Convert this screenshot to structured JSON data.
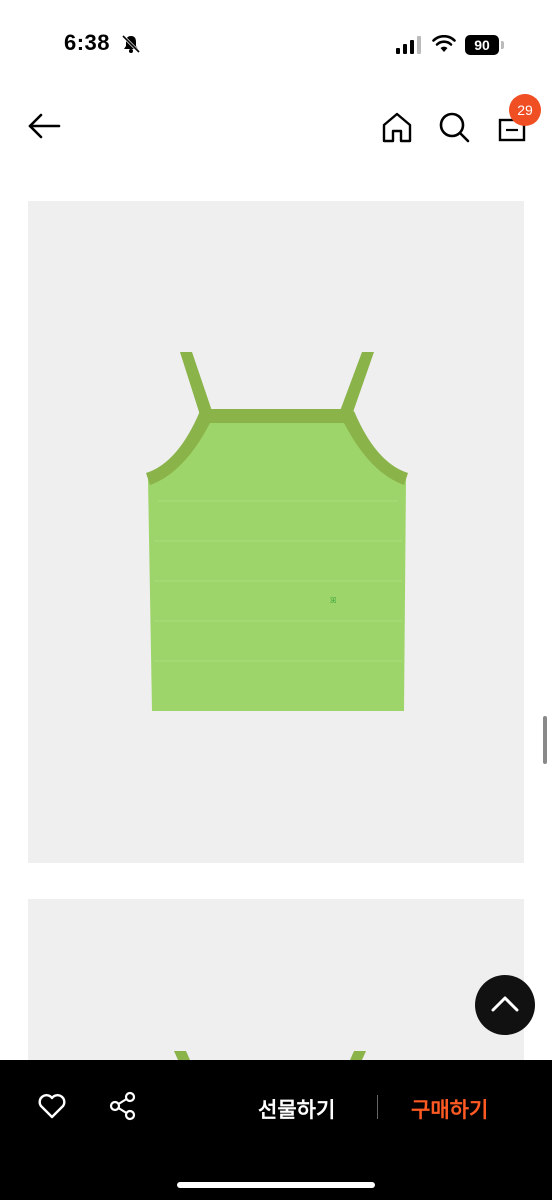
{
  "status_bar": {
    "time": "6:38",
    "battery": "90"
  },
  "header": {
    "cart_count": "29"
  },
  "bottom_bar": {
    "gift_label": "선물하기",
    "buy_label": "구매하기"
  },
  "colors": {
    "accent": "#f04e23",
    "buy_text": "#ff5a23",
    "top_body": "#9ed56a",
    "top_trim": "#8ab34a"
  }
}
